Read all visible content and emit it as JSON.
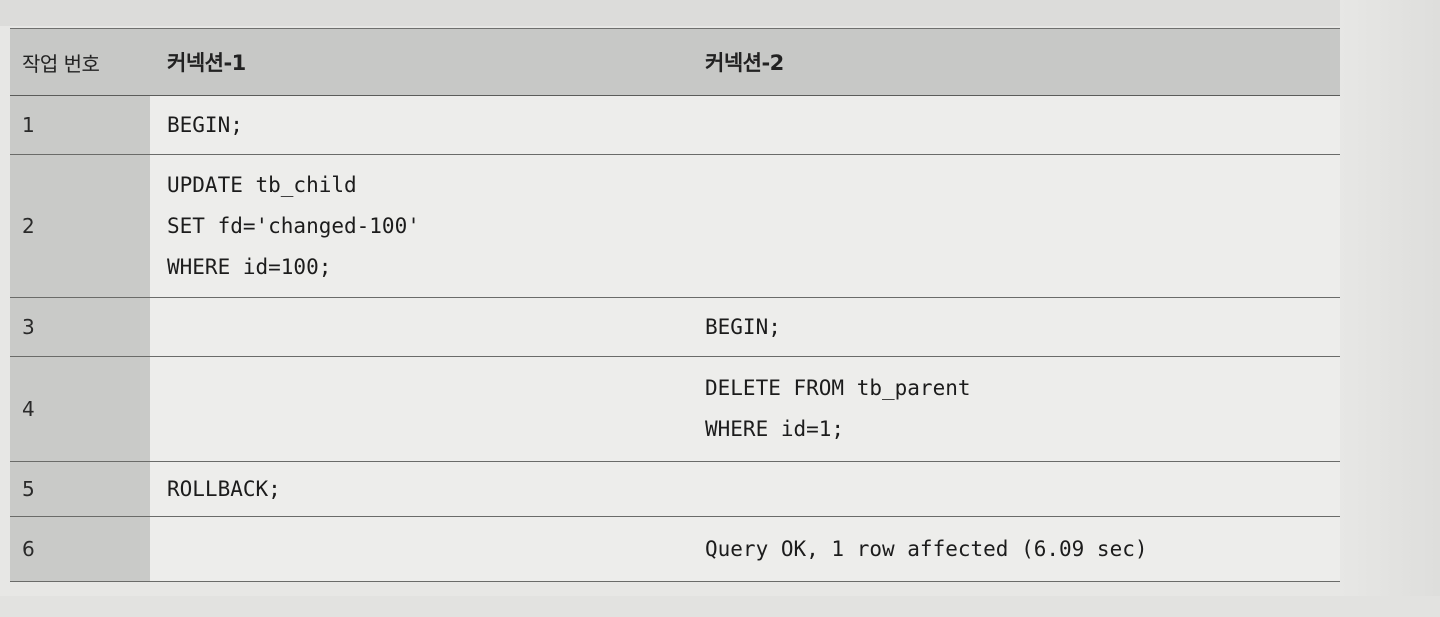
{
  "table": {
    "headers": {
      "num": "작업 번호",
      "conn1": "커넥션-1",
      "conn2": "커넥션-2"
    },
    "rows": [
      {
        "num": "1",
        "conn1": [
          "BEGIN;"
        ],
        "conn2": []
      },
      {
        "num": "2",
        "conn1": [
          "UPDATE tb_child",
          "SET fd='changed-100'",
          "WHERE id=100;"
        ],
        "conn2": []
      },
      {
        "num": "3",
        "conn1": [],
        "conn2": [
          "BEGIN;"
        ]
      },
      {
        "num": "4",
        "conn1": [],
        "conn2": [
          "DELETE FROM tb_parent",
          "WHERE id=1;"
        ]
      },
      {
        "num": "5",
        "conn1": [
          "ROLLBACK;"
        ],
        "conn2": []
      },
      {
        "num": "6",
        "conn1": [],
        "conn2": [
          "Query OK, 1 row affected (6.09 sec)"
        ]
      }
    ]
  }
}
